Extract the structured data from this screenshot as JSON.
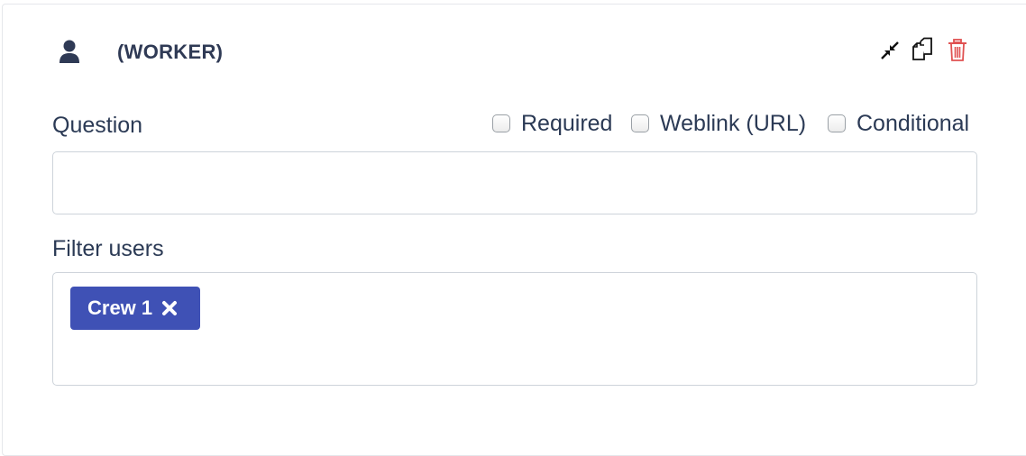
{
  "header": {
    "role": "(WORKER)",
    "icons": [
      "user-icon",
      "collapse-icon",
      "copy-icon",
      "trash-icon"
    ]
  },
  "question": {
    "label": "Question",
    "value": "",
    "options": [
      {
        "label": "Required",
        "checked": false
      },
      {
        "label": "Weblink (URL)",
        "checked": false
      },
      {
        "label": "Conditional",
        "checked": false
      }
    ]
  },
  "filter": {
    "label": "Filter users",
    "tags": [
      {
        "label": "Crew 1"
      }
    ]
  },
  "colors": {
    "tag_bg": "#3f51b5",
    "trash": "#e05252",
    "text": "#2b3a55"
  }
}
